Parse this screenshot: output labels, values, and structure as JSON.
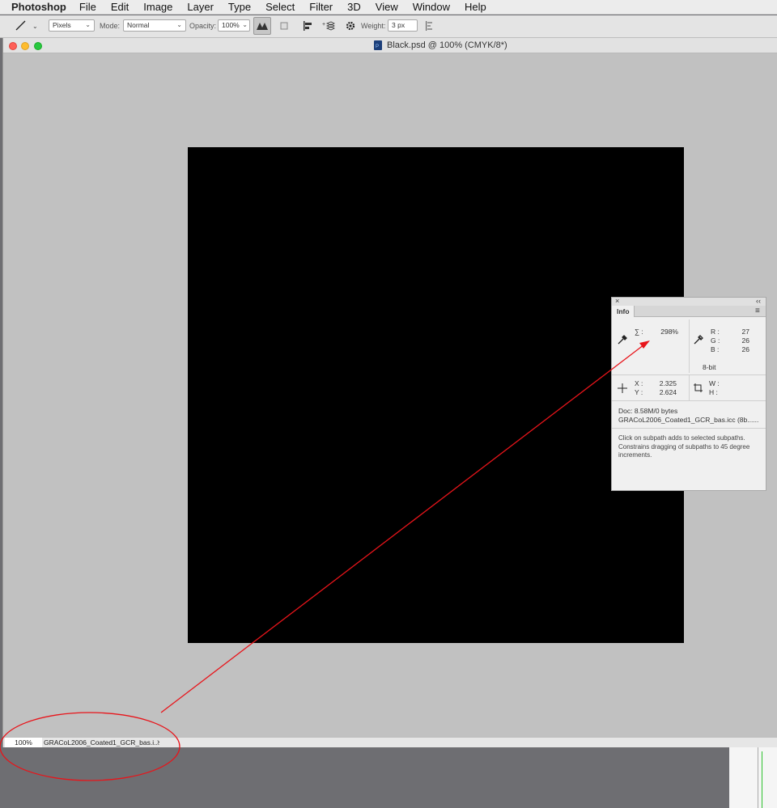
{
  "menubar": {
    "app_name": "Photoshop",
    "items": [
      "File",
      "Edit",
      "Image",
      "Layer",
      "Type",
      "Select",
      "Filter",
      "3D",
      "View",
      "Window",
      "Help"
    ]
  },
  "options_bar": {
    "fill_type": "Pixels",
    "mode_label": "Mode:",
    "mode_value": "Normal",
    "opacity_label": "Opacity:",
    "opacity_value": "100%",
    "weight_label": "Weight:",
    "weight_value": "3 px"
  },
  "document": {
    "title": "Black.psd @ 100% (CMYK/8*)",
    "canvas_color": "#000000"
  },
  "status_bar": {
    "zoom": "100%",
    "profile": "GRACoL2006_Coated1_GCR_bas.i..."
  },
  "info_panel": {
    "tab": "Info",
    "total_ink_label": "∑ :",
    "total_ink_value": "298%",
    "r_label": "R :",
    "r_value": "27",
    "g_label": "G :",
    "g_value": "26",
    "b_label": "B :",
    "b_value": "26",
    "bit_depth": "8-bit",
    "x_label": "X :",
    "x_value": "2.325",
    "y_label": "Y :",
    "y_value": "2.624",
    "w_label": "W :",
    "h_label": "H :",
    "doc_size": "Doc: 8.58M/0 bytes",
    "profile": "GRACoL2006_Coated1_GCR_bas.icc (8b......",
    "hint": "Click on subpath adds to selected subpaths. Constrains dragging of subpaths to 45 degree increments."
  },
  "colors": {
    "annotation": "#e8141a",
    "close": "#fe5f57",
    "minimize": "#febc2e",
    "zoom": "#28c840"
  }
}
